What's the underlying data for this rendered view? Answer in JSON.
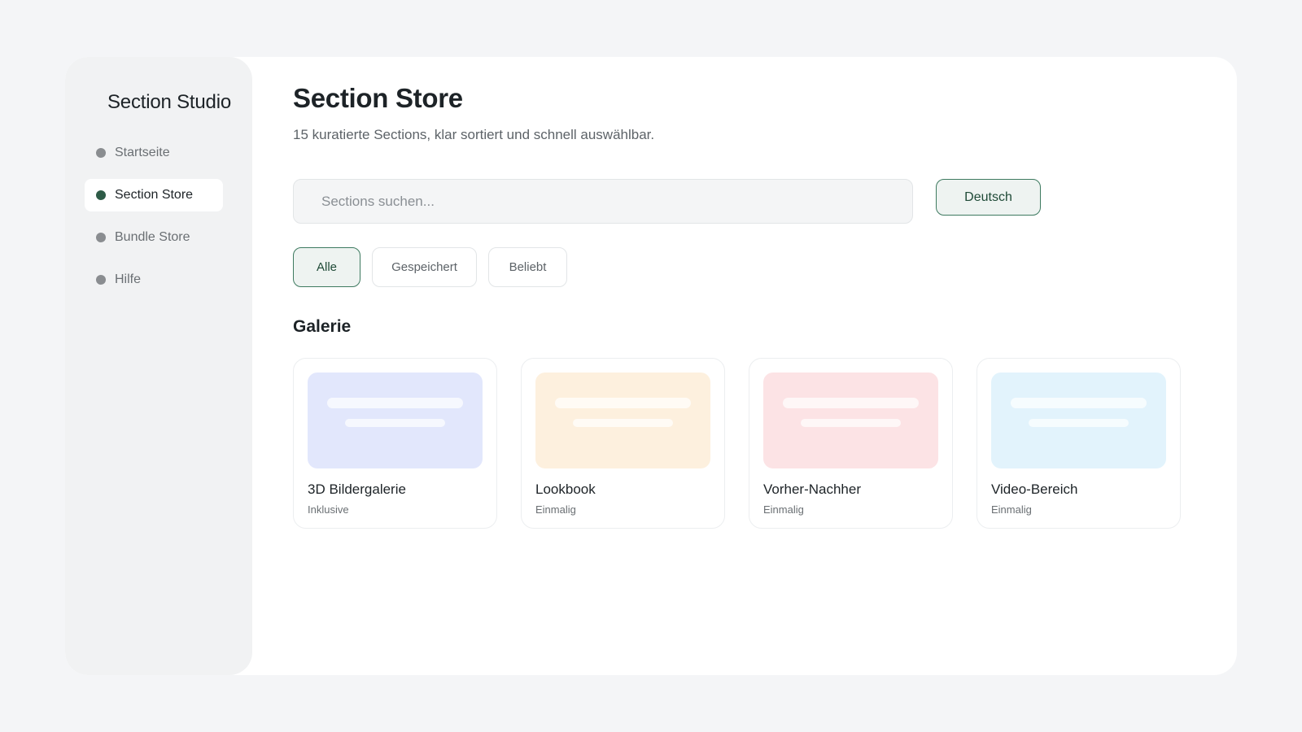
{
  "sidebar": {
    "brand": "Section Studio",
    "items": [
      {
        "label": "Startseite",
        "active": false
      },
      {
        "label": "Section Store",
        "active": true
      },
      {
        "label": "Bundle Store",
        "active": false
      },
      {
        "label": "Hilfe",
        "active": false
      }
    ]
  },
  "header": {
    "title": "Section Store",
    "subtitle": "15 kuratierte Sections, klar sortiert und schnell auswählbar."
  },
  "search": {
    "placeholder": "Sections suchen...",
    "value": ""
  },
  "language": {
    "label": "Deutsch"
  },
  "filters": [
    {
      "label": "Alle",
      "active": true
    },
    {
      "label": "Gespeichert",
      "active": false
    },
    {
      "label": "Beliebt",
      "active": false
    }
  ],
  "gallery": {
    "heading": "Galerie",
    "cards": [
      {
        "title": "3D Bildergalerie",
        "meta": "Inklusive",
        "thumb_color": "#e2e7fc"
      },
      {
        "title": "Lookbook",
        "meta": "Einmalig",
        "thumb_color": "#fdf0de"
      },
      {
        "title": "Vorher-Nachher",
        "meta": "Einmalig",
        "thumb_color": "#fce3e5"
      },
      {
        "title": "Video-Bereich",
        "meta": "Einmalig",
        "thumb_color": "#e2f3fc"
      }
    ]
  },
  "colors": {
    "accent": "#2e5b47",
    "accent_border": "#3e7a60",
    "accent_bg": "#eef3f1",
    "page_bg": "#f4f5f7",
    "sidebar_bg": "#f1f2f3"
  }
}
